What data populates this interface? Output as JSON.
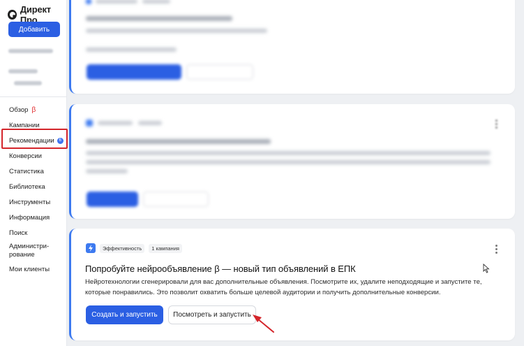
{
  "app": {
    "logo_text": "Директ Про"
  },
  "sidebar": {
    "add_button": "Добавить",
    "items": [
      {
        "label": "Обзор",
        "beta": "β"
      },
      {
        "label": "Кампании"
      },
      {
        "label": "Рекомендации",
        "badge": "6"
      },
      {
        "label": "Конверсии"
      },
      {
        "label": "Статистика"
      },
      {
        "label": "Библиотека"
      },
      {
        "label": "Инструменты"
      },
      {
        "label": "Информация"
      },
      {
        "label": "Поиск"
      },
      {
        "label": "Администри-\nрование"
      },
      {
        "label": "Мои клиенты"
      }
    ]
  },
  "card3": {
    "tag_type": "Эффективность",
    "tag_count": "1 кампания",
    "title": "Попробуйте нейрообъявление β — новый тип объявлений в ЕПК",
    "desc_line1": "Нейротехнологии сгенерировали для вас дополнительные объявления. Посмотрите их, удалите неподходящие и запустите те,",
    "desc_line2": "которые понравились. Это позволит охватить больше целевой аудитории и получить дополнительные конверсии.",
    "primary_button": "Создать и запустить",
    "secondary_button": "Посмотреть и запустить"
  },
  "colors": {
    "accent": "#2b5fe3",
    "highlight": "#d4252b",
    "card_border": "#3d7af0"
  }
}
